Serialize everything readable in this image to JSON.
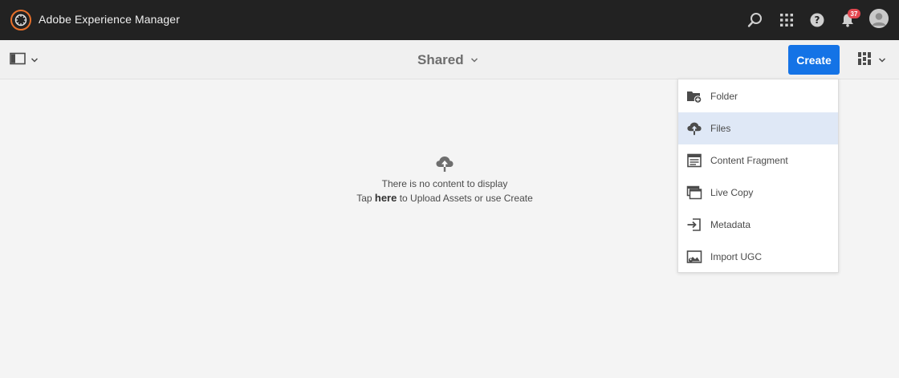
{
  "shell": {
    "title": "Adobe Experience Manager",
    "notification_count": "37",
    "icons": [
      "adobe-logo-icon",
      "search-icon",
      "solutions-grid-icon",
      "help-icon",
      "bell-icon",
      "user-avatar"
    ]
  },
  "actionbar": {
    "rail_toggle_icon": "rail-toggle-icon",
    "location_title": "Shared",
    "create_label": "Create",
    "view_icon": "card-view-icon"
  },
  "empty_state": {
    "line1": "There is no content to display",
    "line2_prefix": "Tap ",
    "line2_link": "here",
    "line2_suffix": " to Upload Assets or use Create",
    "icon": "upload-cloud-icon"
  },
  "create_menu": {
    "items": [
      {
        "label": "Folder",
        "icon": "folder-add-icon",
        "active": false
      },
      {
        "label": "Files",
        "icon": "upload-cloud-icon",
        "active": true
      },
      {
        "label": "Content Fragment",
        "icon": "content-fragment-icon",
        "active": false
      },
      {
        "label": "Live Copy",
        "icon": "live-copy-icon",
        "active": false
      },
      {
        "label": "Metadata",
        "icon": "metadata-import-icon",
        "active": false
      },
      {
        "label": "Import UGC",
        "icon": "import-ugc-icon",
        "active": false
      }
    ]
  },
  "colors": {
    "shell_bg": "#222222",
    "accent": "#1473e6",
    "badge": "#e34850",
    "menu_active": "#dfe8f6"
  }
}
